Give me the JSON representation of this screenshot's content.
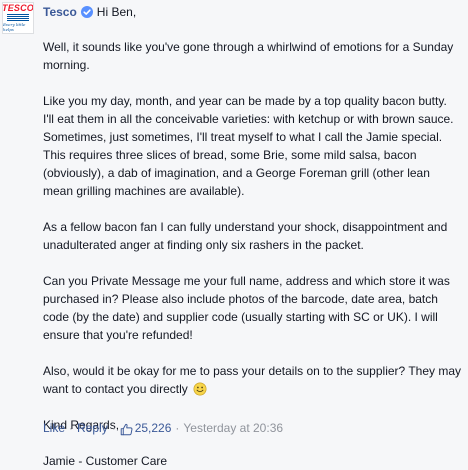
{
  "comment": {
    "author": "Tesco",
    "author_logo": {
      "word": "TESCO",
      "tagline": "Every little helps"
    },
    "greeting": "Hi Ben,",
    "paragraphs": [
      "Well, it sounds like you've gone through a whirlwind of emotions for a Sunday morning.",
      "Like you my day, month, and year can be made by a top quality bacon butty. I'll eat them in all the conceivable varieties: with ketchup or with brown sauce. Sometimes, just sometimes, I'll treat myself to what I call the Jamie special. This requires three slices of bread, some Brie, some mild salsa, bacon (obviously), a dab of imagination, and a George Foreman grill (other lean mean grilling machines are available).",
      "As a fellow bacon fan I can fully understand your shock, disappointment and unadulterated anger at finding only six rashers in the packet.",
      "Can you Private Message me your full name, address and which store it was purchased in? Please also include photos of the barcode, date area, batch code (by the date) and supplier code (usually starting with SC or UK). I will ensure that you're refunded!",
      "Also, would it be okay for me to pass your details on to the supplier? They may want to contact you directly",
      "Kind Regards,",
      "Jamie - Customer Care"
    ],
    "smiley_icon": "smiley-emoji",
    "verified_icon": "verified-badge",
    "actions": {
      "like_label": "Like",
      "reply_label": "Reply",
      "like_count": "25,226",
      "timestamp": "Yesterday at 20:36"
    }
  },
  "colors": {
    "link": "#3b5998",
    "text": "#141823",
    "muted": "#90949c",
    "background": "#f6f7f9",
    "brand_red": "#ee1c2e",
    "brand_blue": "#00539f",
    "verified": "#5890ff"
  }
}
